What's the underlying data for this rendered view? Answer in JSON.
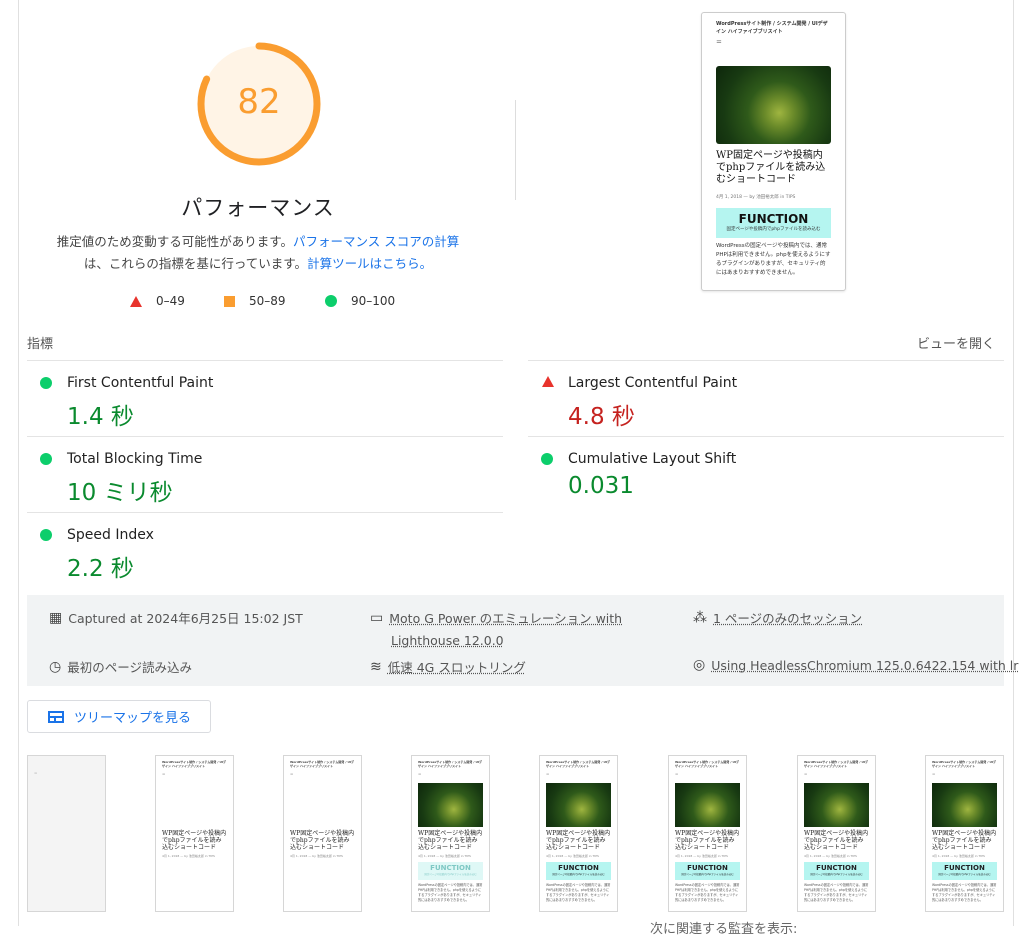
{
  "score": {
    "value": 82,
    "label": "パフォーマンス",
    "color": "#fa9d30",
    "fraction": 0.82
  },
  "description": {
    "text1": "推定値のため変動する可能性があります。",
    "link1": "パフォーマンス スコアの計算",
    "text2": "は、これらの指標を基に行っています。",
    "link2": "計算ツールはこちら。"
  },
  "legend": [
    {
      "shape": "triangle",
      "range": "0–49",
      "color": "#e8332c"
    },
    {
      "shape": "square",
      "range": "50–89",
      "color": "#fa9d30"
    },
    {
      "shape": "circle",
      "range": "90–100",
      "color": "#0cce6b"
    }
  ],
  "screenshot": {
    "site_title": "WordPressサイト制作 / システム開発 / UIデザイン ハイファイブブリスイト",
    "menu": "=",
    "post_title": "WP固定ページや投稿内でphpファイルを読み込むショートコード",
    "meta": "4月 1, 2018 — by 池田裕太郎 in TIPS",
    "function_heading": "FUNCTION",
    "function_sub": "固定ページや投稿内でphpファイルを読み込む",
    "paragraph": "WordPressの固定ページや投稿内では、通常PHPは利用できません。phpを使えるようにするプラグインがありますが、セキュリティ的にはあまりおすすめできません。"
  },
  "metrics": {
    "section_label": "指標",
    "view_toggle": "ビューを開く",
    "items": [
      {
        "name": "First Contentful Paint",
        "value": "1.4 秒",
        "status": "good"
      },
      {
        "name": "Largest Contentful Paint",
        "value": "4.8 秒",
        "status": "bad"
      },
      {
        "name": "Total Blocking Time",
        "value": "10 ミリ秒",
        "status": "good"
      },
      {
        "name": "Cumulative Layout Shift",
        "value": "0.031",
        "status": "good"
      },
      {
        "name": "Speed Index",
        "value": "2.2 秒",
        "status": "good"
      }
    ]
  },
  "environment": {
    "captured": "Captured at 2024年6月25日 15:02 JST",
    "device_line1": "Moto G Power のエミュレーション with",
    "device_line2": "Lighthouse 12.0.0",
    "session": "1 ページのみのセッション",
    "load": "最初のページ読み込み",
    "throttling": "低速 4G スロットリング",
    "browser": "Using HeadlessChromium 125.0.6422.154 with lr"
  },
  "treemap_button": "ツリーマップを見る",
  "bottom_partial": "次に関連する監査を表示: "
}
